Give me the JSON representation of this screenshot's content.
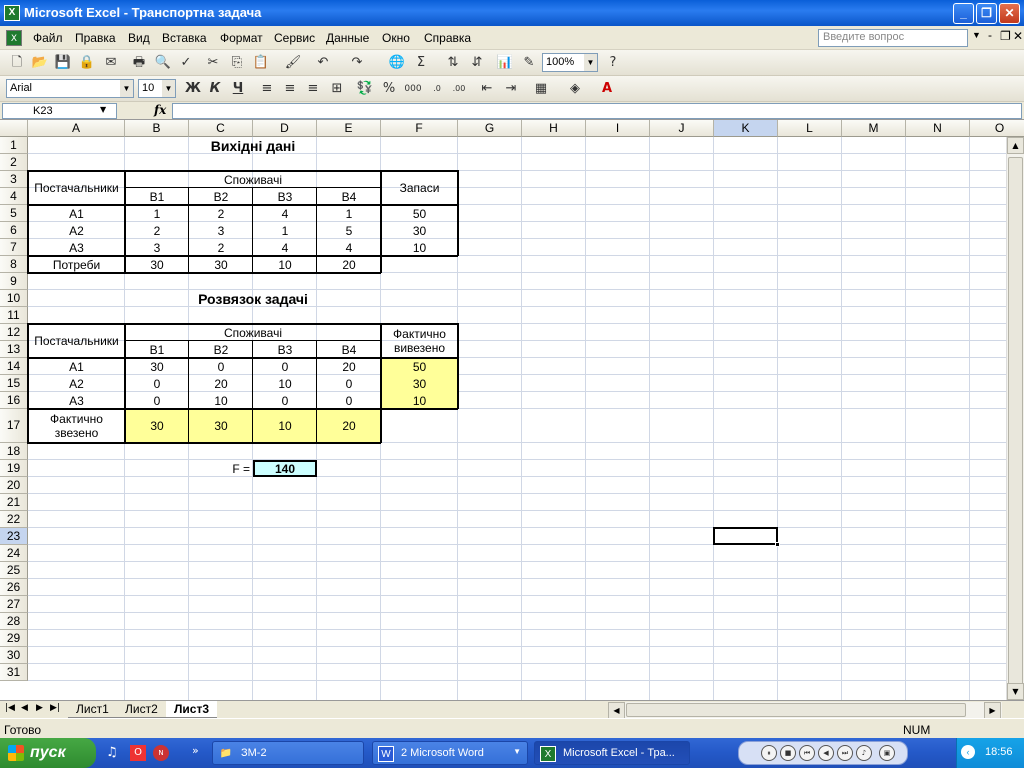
{
  "window": {
    "title": "Microsoft Excel - Транспортна задача"
  },
  "menu": {
    "items": [
      "Файл",
      "Правка",
      "Вид",
      "Вставка",
      "Формат",
      "Сервис",
      "Данные",
      "Окно",
      "Справка"
    ],
    "ask_placeholder": "Введите вопрос"
  },
  "toolbar": {
    "zoom": "100%",
    "font": "Arial",
    "font_size": "10",
    "bold": "Ж",
    "italic": "К",
    "underline": "Ч"
  },
  "formula_bar": {
    "name_box": "K23",
    "fx": "fx"
  },
  "grid": {
    "columns": [
      "A",
      "B",
      "C",
      "D",
      "E",
      "F",
      "G",
      "H",
      "I",
      "J",
      "K",
      "L",
      "M",
      "N",
      "O"
    ],
    "rows": [
      "1",
      "2",
      "3",
      "4",
      "5",
      "6",
      "7",
      "8",
      "9",
      "10",
      "11",
      "12",
      "13",
      "14",
      "15",
      "16",
      "17",
      "18",
      "19",
      "20",
      "21",
      "22",
      "23",
      "24",
      "25",
      "26",
      "27",
      "28",
      "29",
      "30",
      "31"
    ],
    "active_cell": "K23"
  },
  "input_data": {
    "title": "Вихідні дані",
    "suppliers_header": "Постачальники",
    "consumers_header": "Споживачі",
    "stock_header": "Запаси",
    "consumers": [
      "B1",
      "B2",
      "B3",
      "B4"
    ],
    "rows": [
      {
        "supplier": "A1",
        "costs": [
          "1",
          "2",
          "4",
          "1"
        ],
        "stock": "50"
      },
      {
        "supplier": "A2",
        "costs": [
          "2",
          "3",
          "1",
          "5"
        ],
        "stock": "30"
      },
      {
        "supplier": "A3",
        "costs": [
          "3",
          "2",
          "4",
          "4"
        ],
        "stock": "10"
      }
    ],
    "demand_label": "Потреби",
    "demand": [
      "30",
      "30",
      "10",
      "20"
    ]
  },
  "solution": {
    "title": "Розвязок задачі",
    "suppliers_header": "Постачальники",
    "consumers_header": "Споживачі",
    "shipped_header": "Фактично вивезено",
    "consumers": [
      "B1",
      "B2",
      "B3",
      "B4"
    ],
    "rows": [
      {
        "supplier": "A1",
        "values": [
          "30",
          "0",
          "0",
          "20"
        ],
        "shipped": "50"
      },
      {
        "supplier": "A2",
        "values": [
          "0",
          "20",
          "10",
          "0"
        ],
        "shipped": "30"
      },
      {
        "supplier": "A3",
        "values": [
          "0",
          "10",
          "0",
          "0"
        ],
        "shipped": "10"
      }
    ],
    "received_label": "Фактично звезено",
    "received": [
      "30",
      "30",
      "10",
      "20"
    ],
    "objective_label": "F =",
    "objective_value": "140"
  },
  "sheets": {
    "tabs": [
      "Лист1",
      "Лист2",
      "Лист3"
    ],
    "active": "Лист3"
  },
  "status": {
    "left": "Готово",
    "num": "NUM"
  },
  "taskbar": {
    "start": "пуск",
    "buttons": [
      {
        "label": "ЗМ-2",
        "icon": "folder-icon"
      },
      {
        "label": "2 Microsoft Word",
        "icon": "word-icon"
      },
      {
        "label": "Microsoft Excel - Тра...",
        "icon": "excel-icon"
      }
    ],
    "clock": "18:56"
  },
  "colors": {
    "yellow": "#ffff99",
    "cyan": "#ccffff",
    "title_blue": "#0a5fd8"
  }
}
